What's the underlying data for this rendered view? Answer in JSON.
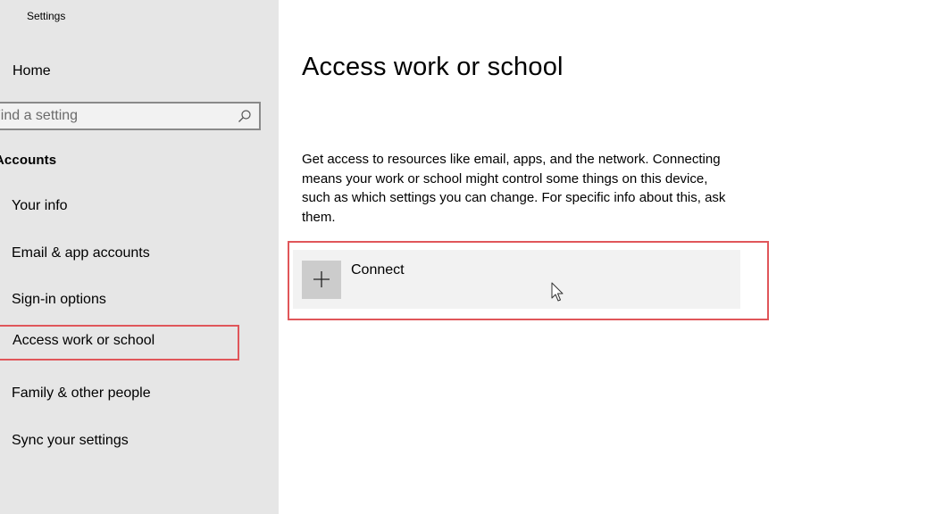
{
  "window": {
    "title": "Settings"
  },
  "sidebar": {
    "home_label": "Home",
    "search": {
      "placeholder": "Find a setting",
      "icon": "search-icon"
    },
    "section_title": "Accounts",
    "items": [
      {
        "label": "Your info",
        "selected": false
      },
      {
        "label": "Email & app accounts",
        "selected": false
      },
      {
        "label": "Sign-in options",
        "selected": false
      },
      {
        "label": "Access work or school",
        "selected": true
      },
      {
        "label": "Family & other people",
        "selected": false
      },
      {
        "label": "Sync your settings",
        "selected": false
      }
    ]
  },
  "main": {
    "title": "Access work or school",
    "description": "Get access to resources like email, apps, and the network. Connecting means your work or school might control some things on this device, such as which settings you can change. For specific info about this, ask them.",
    "connect": {
      "label": "Connect",
      "icon": "plus-icon"
    }
  },
  "colors": {
    "sidebar_bg": "#e6e6e6",
    "highlight_border": "#e0565a",
    "connect_bg": "#f2f2f2",
    "plus_tile_bg": "#cccccc"
  }
}
